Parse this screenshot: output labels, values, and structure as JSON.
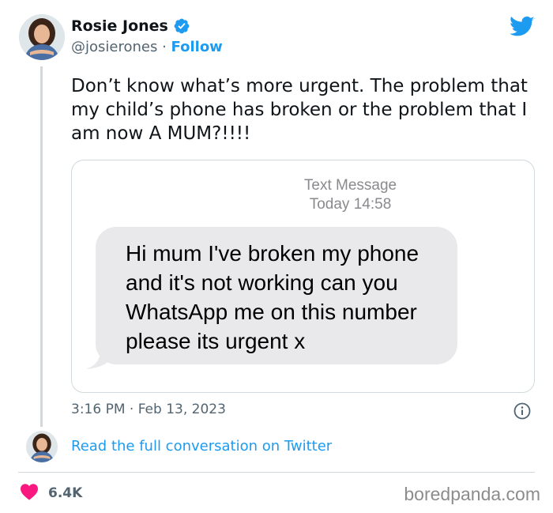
{
  "author": {
    "name": "Rosie Jones",
    "handle": "@josierones",
    "separator": "·",
    "follow_label": "Follow",
    "verified": true
  },
  "tweet": {
    "text": "Don’t know what’s more urgent. The problem that my child’s phone has broken or the problem that I am now A MUM?!!!!",
    "timestamp": "3:16 PM · Feb 13, 2023"
  },
  "sms": {
    "header_title": "Text Message",
    "header_time": "Today 14:58",
    "message": "Hi mum I've broken my phone and it's not working can you WhatsApp me on this number please its urgent x"
  },
  "footer": {
    "read_more_label": "Read the full conversation on Twitter",
    "like_count": "6.4K",
    "watermark": "boredpanda.com"
  },
  "icons": {
    "brand": "twitter-bird-icon",
    "verified": "verified-badge-icon",
    "info": "info-icon",
    "like": "heart-icon"
  },
  "colors": {
    "accent": "#1d9bf0",
    "text_primary": "#0f1419",
    "text_secondary": "#536471",
    "like": "#f91880",
    "bubble": "#e9e9eb",
    "border": "#cfd9de"
  }
}
